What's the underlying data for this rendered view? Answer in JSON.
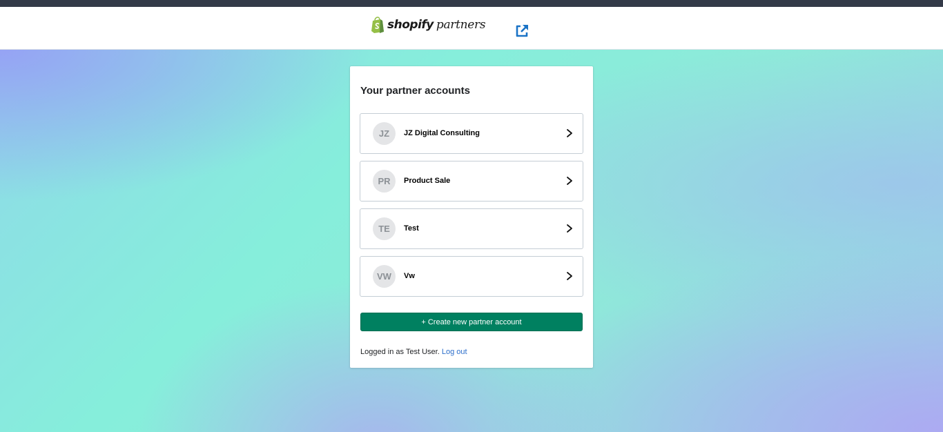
{
  "header": {
    "logo_word": "shopify",
    "logo_sub": "partners",
    "external_link_icon": "external-link-icon",
    "colors": {
      "topbar": "#333a48",
      "logo_green": "#95bf47",
      "link_blue": "#1a73c6"
    }
  },
  "main": {
    "title": "Your partner accounts",
    "accounts": [
      {
        "initials": "JZ",
        "name": "JZ Digital Consulting"
      },
      {
        "initials": "PR",
        "name": "Product Sale"
      },
      {
        "initials": "TE",
        "name": "Test"
      },
      {
        "initials": "VW",
        "name": "Vw"
      }
    ],
    "create_button_label": "+ Create new partner account",
    "logged_in_text": "Logged in as Test User.",
    "logout_label": "Log out",
    "colors": {
      "primary": "#008060",
      "avatar_bg": "#e4e5e7"
    }
  }
}
